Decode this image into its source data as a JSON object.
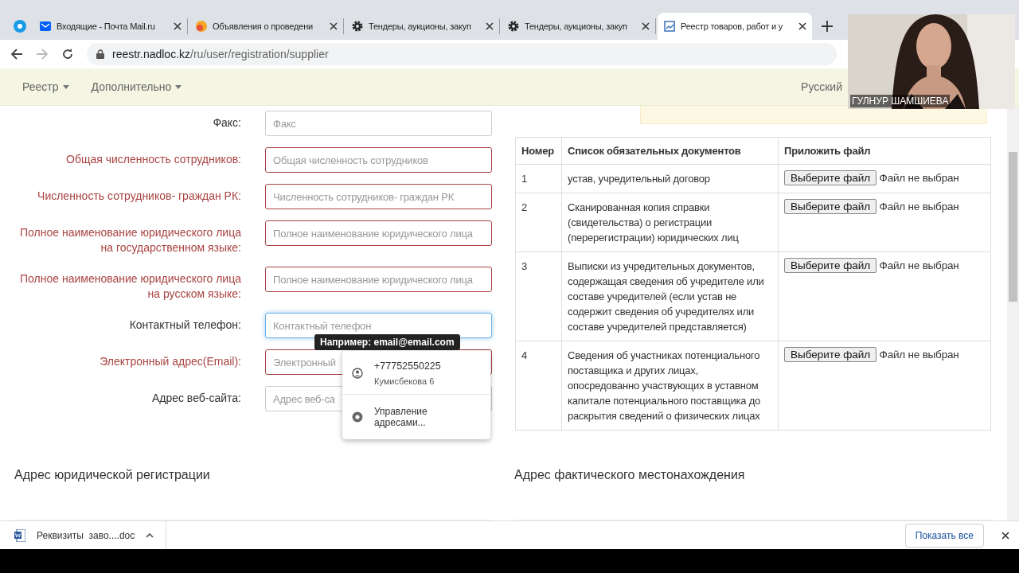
{
  "browser": {
    "tabs": [
      {
        "selected": false
      },
      {
        "title": "Входящие - Почта Mail.ru",
        "selected": false
      },
      {
        "title": "Объявления о проведени",
        "selected": false
      },
      {
        "title": "Тендеры, аукционы, закуп",
        "selected": false
      },
      {
        "title": "Тендеры, аукционы, закуп",
        "selected": false
      },
      {
        "title": "Реестр товаров, работ и у",
        "selected": true
      }
    ],
    "address_host": "reestr.nadloc.kz",
    "address_path": "/ru/user/registration/supplier"
  },
  "navbar": {
    "menus": [
      "Реестр",
      "Дополнительно"
    ],
    "language": "Русский"
  },
  "form": {
    "fields": [
      {
        "label": "Факс:",
        "placeholder": "Факс",
        "invalid": false,
        "focused": false
      },
      {
        "label": "Общая численность сотрудников:",
        "placeholder": "Общая численность сотрудников",
        "invalid": true,
        "focused": false
      },
      {
        "label": "Численность сотрудников- граждан РК:",
        "placeholder": "Численность сотрудников- граждан РК",
        "invalid": true,
        "focused": false
      },
      {
        "label": "Полное наименование юридического лица на государственном языке:",
        "placeholder": "Полное наименование юридического лица",
        "invalid": true,
        "focused": false
      },
      {
        "label": "Полное наименование юридического лица на русском языке:",
        "placeholder": "Полное наименование юридического лица",
        "invalid": true,
        "focused": false
      },
      {
        "label": "Контактный телефон:",
        "placeholder": "Контактный телефон",
        "invalid": false,
        "focused": true
      },
      {
        "label": "Электронный адрес(Email):",
        "placeholder": "Электронный",
        "invalid": true,
        "focused": false
      },
      {
        "label": "Адрес веб-сайта:",
        "placeholder": "Адрес веб-са",
        "invalid": false,
        "focused": false
      }
    ],
    "tooltip": "Например: email@email.com",
    "autofill": {
      "phone": "+77752550225",
      "address": "Кумисбекова 6",
      "manage": "Управление адресами..."
    }
  },
  "table": {
    "columns": [
      "Номер",
      "Список обязательных документов",
      "Приложить файл"
    ],
    "rows": [
      {
        "number": "1",
        "document": "устав, учредительный договор",
        "button": "Выберите файл",
        "status": "Файл не выбран"
      },
      {
        "number": "2",
        "document": "Сканированная копия справки (свидетельства) о регистрации (перерегистрации) юридических лиц",
        "button": "Выберите файл",
        "status": "Файл не выбран"
      },
      {
        "number": "3",
        "document": "Выписки из учредительных документов, содержащая сведения об учредителе или составе учредителей (если устав не содержит сведения об учредителях или составе учредителей представляется)",
        "button": "Выберите файл",
        "status": "Файл не выбран"
      },
      {
        "number": "4",
        "document": "Сведения об участниках потенциального поставщика и других лицах, опосредованно участвующих в уставном капитале потенциального поставщика до раскрытия сведений о физических лицах",
        "button": "Выберите файл",
        "status": "Файл не выбран"
      }
    ]
  },
  "sections": [
    "Адрес юридической регистрации",
    "Адрес фактического местонахождения"
  ],
  "downloads": {
    "file": "Реквизиты  заво....doc",
    "show_all": "Показать все"
  },
  "webcam": {
    "caption": "ГУЛНУР ШАМШИЕВА"
  }
}
